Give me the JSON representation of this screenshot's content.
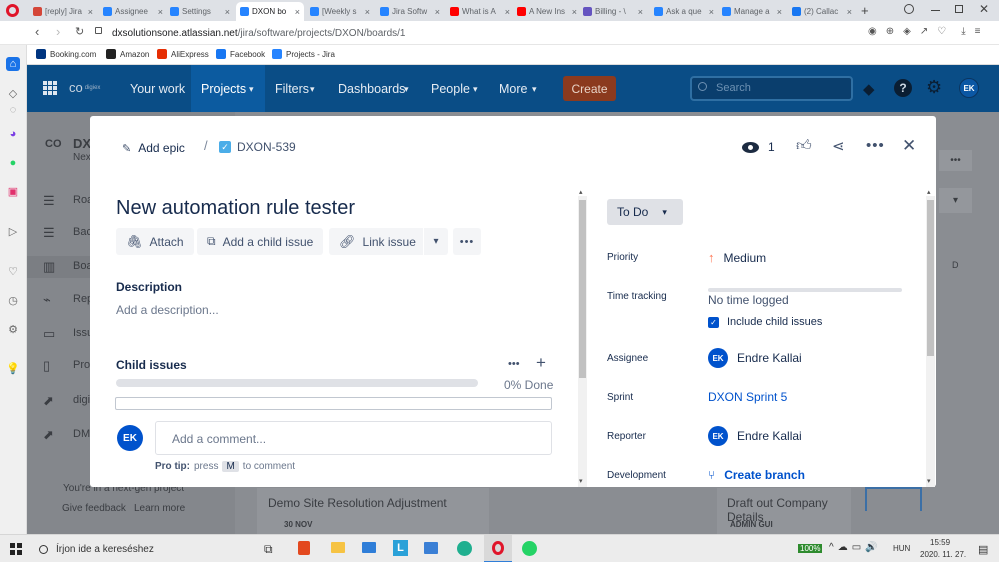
{
  "browser": {
    "tabs": [
      {
        "label": "[reply] Jira",
        "color": "#d44638"
      },
      {
        "label": "Assignee",
        "color": "#2684ff"
      },
      {
        "label": "Settings",
        "color": "#2684ff"
      },
      {
        "label": "DXON bo",
        "color": "#2684ff"
      },
      {
        "label": "[Weekly s",
        "color": "#2684ff"
      },
      {
        "label": "Jira Softw",
        "color": "#2684ff"
      },
      {
        "label": "What is A",
        "color": "#ff0000"
      },
      {
        "label": "A New Ins",
        "color": "#ff0000"
      },
      {
        "label": "Billing - \\",
        "color": "#6554c0"
      },
      {
        "label": "Ask a que",
        "color": "#2684ff"
      },
      {
        "label": "Manage a",
        "color": "#2684ff"
      },
      {
        "label": "(2) Callac",
        "color": "#1877f2"
      }
    ],
    "new_tab_label": "+",
    "url_domain": "dxsolutionsone.atlassian.net",
    "url_path": "/jira/software/projects/DXON/boards/1",
    "bookmarks": [
      {
        "label": "Booking.com",
        "color": "#003580"
      },
      {
        "label": "Amazon",
        "color": "#222222"
      },
      {
        "label": "AliExpress",
        "color": "#e62e04"
      },
      {
        "label": "Facebook",
        "color": "#1877f2"
      },
      {
        "label": "Projects - Jira",
        "color": "#2684ff"
      }
    ]
  },
  "jira_nav": {
    "logo": "digiex",
    "items": [
      "Your work",
      "Projects",
      "Filters",
      "Dashboards",
      "People",
      "More"
    ],
    "create_label": "Create",
    "search_placeholder": "Search",
    "avatar": "EK"
  },
  "background": {
    "project_short": "DX",
    "project_sub": "Nex",
    "sidebar_items": [
      "Roa",
      "Bac",
      "Boa",
      "Rep",
      "Issu",
      "Pro",
      "digi",
      "DM"
    ],
    "next_gen_text": "You're in a next-gen project",
    "give_feedback": "Give feedback",
    "learn_more": "Learn more",
    "card_title": "Demo Site Resolution Adjustment",
    "card_date": "30 NOV",
    "card2_title": "Draft out Company Details",
    "card2_label": "ADMIN GUI",
    "col_letter": "D"
  },
  "modal": {
    "add_epic": "Add epic",
    "issue_key": "DXON-539",
    "watch_count": "1",
    "title": "New automation rule tester",
    "buttons": {
      "attach": "Attach",
      "child": "Add a child issue",
      "link": "Link issue"
    },
    "description_label": "Description",
    "description_placeholder": "Add a description...",
    "child_issues_label": "Child issues",
    "progress_done": "0% Done",
    "progress_fraction": 0,
    "comment_placeholder": "Add a comment...",
    "comment_avatar": "EK",
    "protip_prefix": "Pro tip:",
    "protip_press": "press",
    "protip_key": "M",
    "protip_suffix": "to comment",
    "status": "To Do",
    "fields": {
      "priority_label": "Priority",
      "priority_value": "Medium",
      "time_label": "Time tracking",
      "time_value": "No time logged",
      "include_child": "Include child issues",
      "assignee_label": "Assignee",
      "assignee_value": "Endre Kallai",
      "assignee_avatar": "EK",
      "sprint_label": "Sprint",
      "sprint_value": "DXON Sprint 5",
      "reporter_label": "Reporter",
      "reporter_value": "Endre Kallai",
      "reporter_avatar": "EK",
      "development_label": "Development",
      "development_value": "Create branch"
    }
  },
  "taskbar": {
    "search_placeholder": "Írjon ide a kereséshez",
    "battery": "100%",
    "lang": "HUN",
    "time": "15:59",
    "date": "2020. 11. 27."
  },
  "colors": {
    "jira_blue": "#0052cc",
    "nav_bg": "#0a4d86",
    "create_bg": "#8b3a1e"
  }
}
